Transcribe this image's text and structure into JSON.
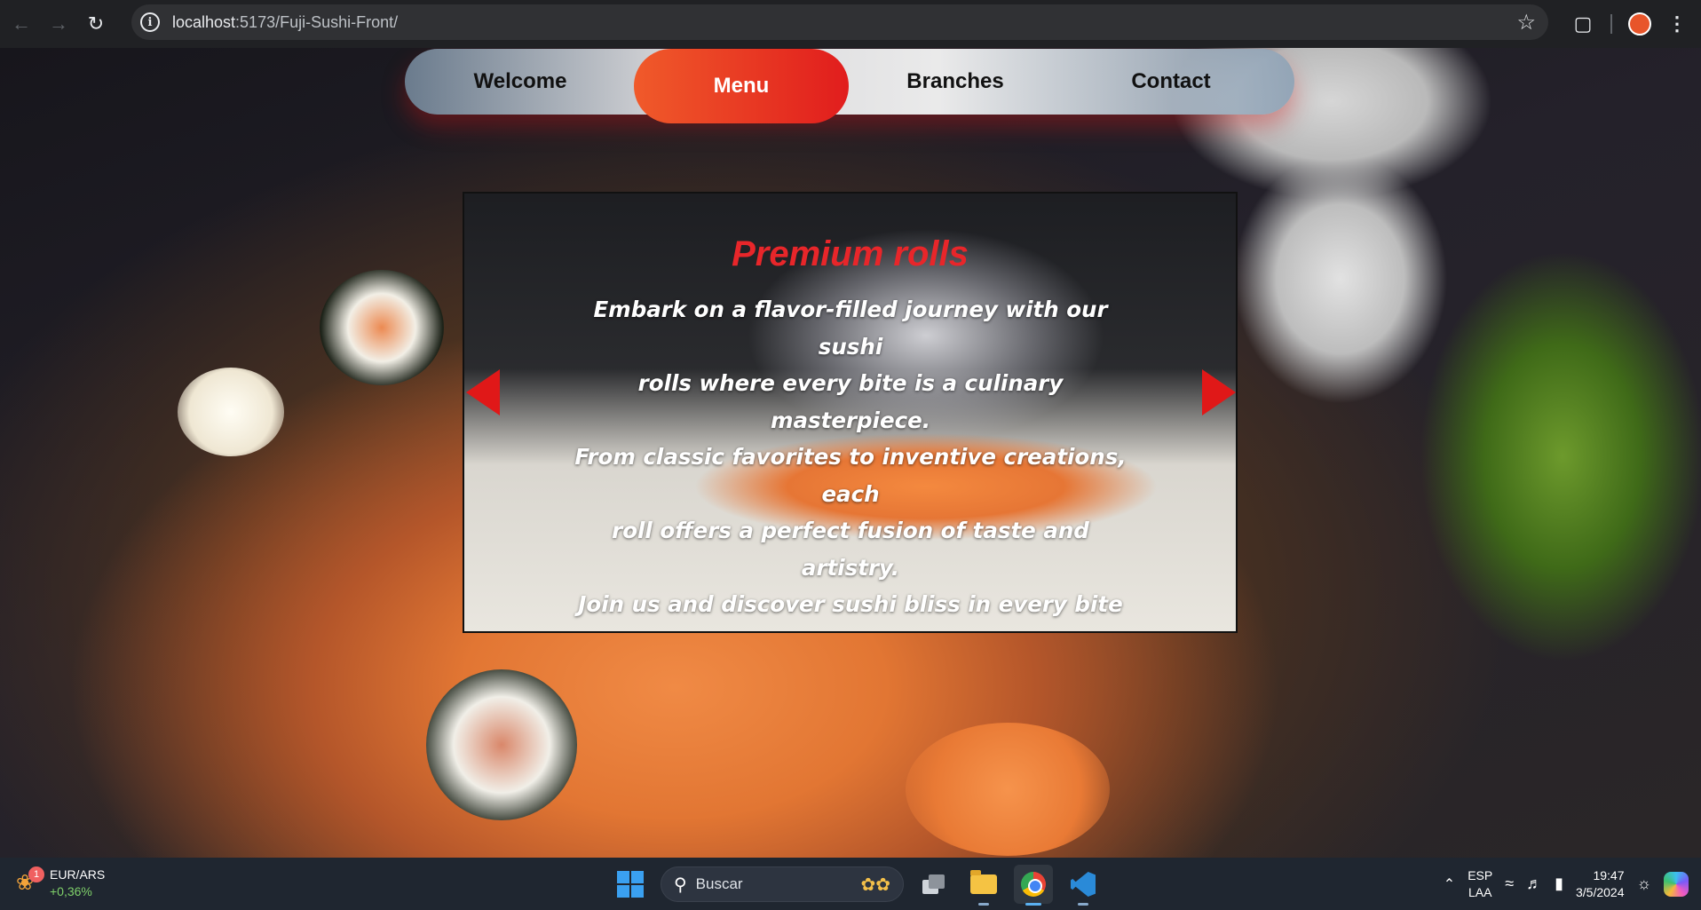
{
  "browser": {
    "url_host": "localhost",
    "url_path": ":5173/Fuji-Sushi-Front/",
    "back_icon": "arrow-left-icon",
    "forward_icon": "arrow-right-icon",
    "reload_icon": "reload-icon",
    "site_info_icon": "info-icon",
    "bookmark_icon": "star-icon",
    "extensions_icon": "puzzle-icon",
    "menu_icon": "kebab-icon"
  },
  "nav": {
    "items": [
      {
        "label": "Welcome"
      },
      {
        "label": "Menu"
      },
      {
        "label": "Branches"
      },
      {
        "label": "Contact"
      }
    ],
    "active_index": 1,
    "active_color_start": "#f05a2a",
    "active_color_end": "#e11d1d"
  },
  "slide": {
    "title": "Premium rolls",
    "lines": [
      "Embark on a flavor-filled journey with our sushi",
      "rolls where every bite is a culinary masterpiece.",
      "From classic favorites to inventive creations, each",
      "roll offers a perfect fusion of taste and artistry.",
      "Join us and discover sushi bliss in every bite"
    ],
    "title_color": "#e8262a",
    "arrow_color": "#e01818"
  },
  "taskbar": {
    "widget": {
      "badge": "1",
      "pair": "EUR/ARS",
      "delta": "+0,36%"
    },
    "search_placeholder": "Buscar",
    "apps": [
      "windows-start-icon",
      "task-view-icon",
      "file-explorer-icon",
      "chrome-icon",
      "vscode-icon"
    ],
    "lang_top": "ESP",
    "lang_bottom": "LAA",
    "time": "19:47",
    "date": "3/5/2024"
  }
}
